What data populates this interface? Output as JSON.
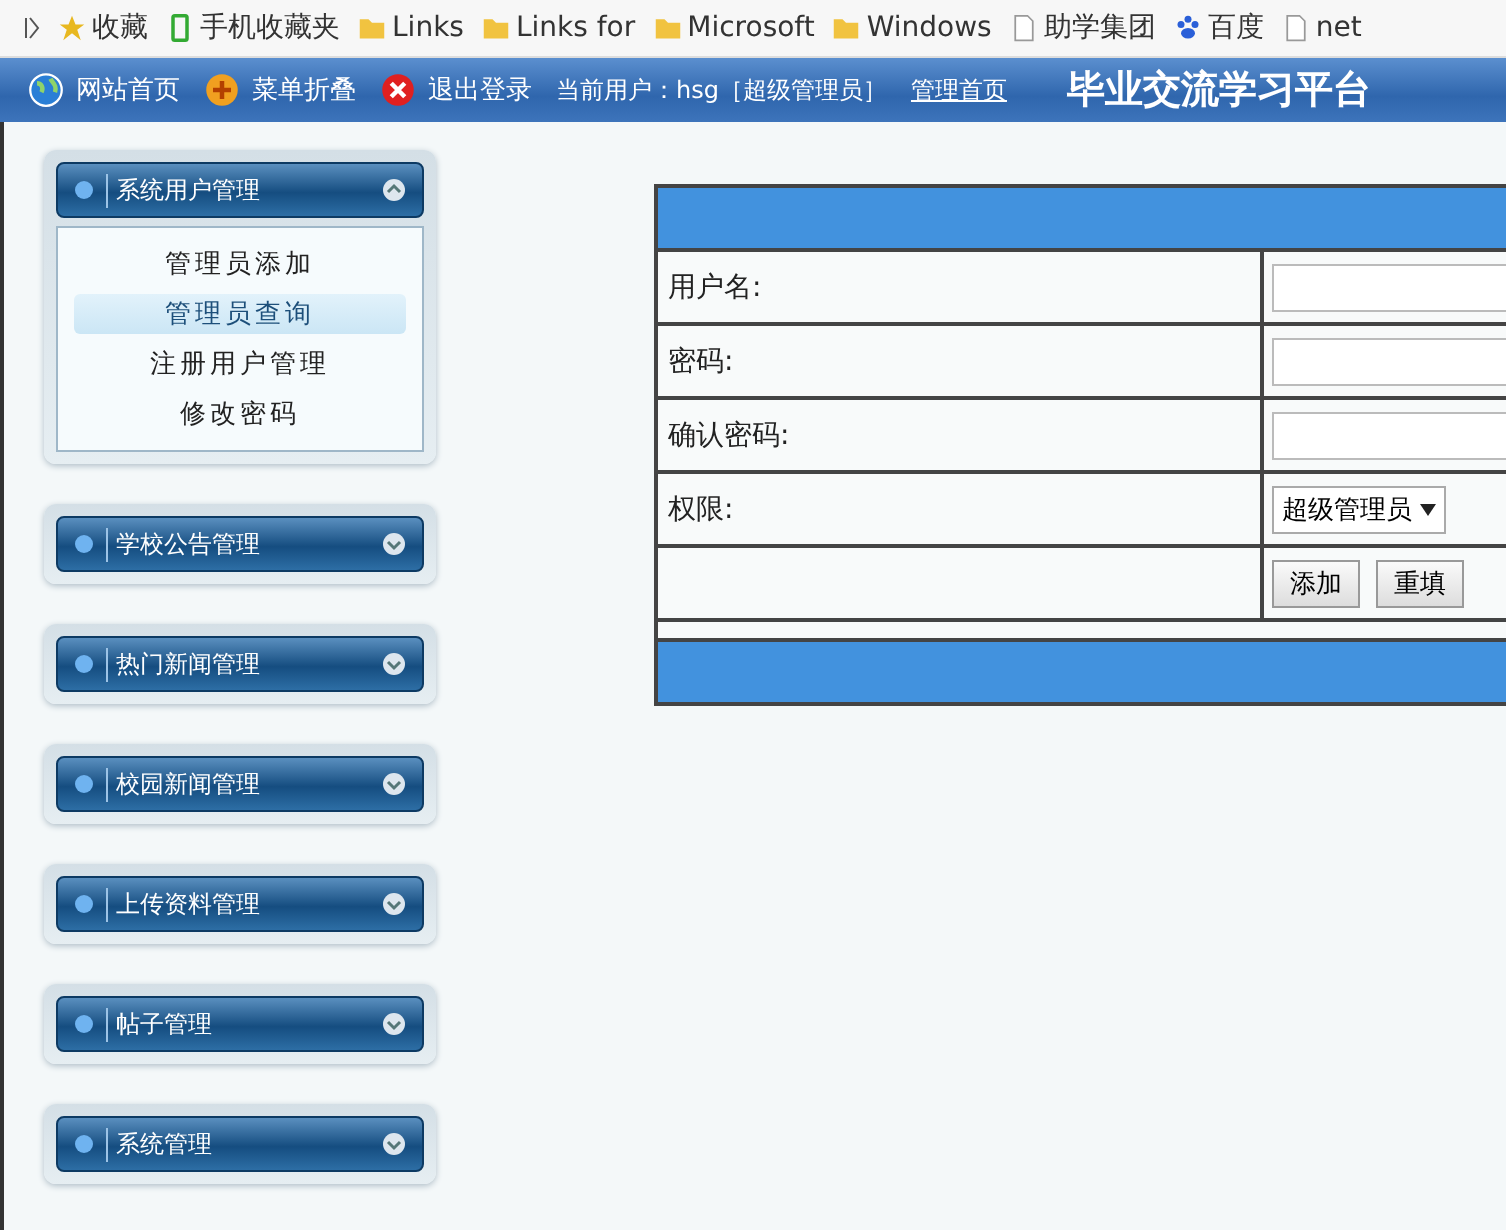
{
  "bookmarks": [
    {
      "label": "收藏",
      "kind": "star"
    },
    {
      "label": "手机收藏夹",
      "kind": "phone"
    },
    {
      "label": "Links",
      "kind": "folder"
    },
    {
      "label": "Links for",
      "kind": "folder"
    },
    {
      "label": "Microsoft",
      "kind": "folder"
    },
    {
      "label": "Windows",
      "kind": "folder"
    },
    {
      "label": "助学集团",
      "kind": "page"
    },
    {
      "label": "百度",
      "kind": "paw"
    },
    {
      "label": "net",
      "kind": "page"
    }
  ],
  "topbar": {
    "links": [
      {
        "label": "网站首页",
        "kind": "globe"
      },
      {
        "label": "菜单折叠",
        "kind": "plus"
      },
      {
        "label": "退出登录",
        "kind": "close"
      }
    ],
    "current_user": "当前用户：hsg［超级管理员］",
    "home_link": "管理首页",
    "title": "毕业交流学习平台"
  },
  "sidebar": [
    {
      "title": "系统用户管理",
      "expanded": true,
      "children": [
        {
          "label": "管理员添加",
          "selected": false
        },
        {
          "label": "管理员查询",
          "selected": true
        },
        {
          "label": "注册用户管理",
          "selected": false
        },
        {
          "label": "修改密码",
          "selected": false
        }
      ]
    },
    {
      "title": "学校公告管理",
      "expanded": false
    },
    {
      "title": "热门新闻管理",
      "expanded": false
    },
    {
      "title": "校园新闻管理",
      "expanded": false
    },
    {
      "title": "上传资料管理",
      "expanded": false
    },
    {
      "title": "帖子管理",
      "expanded": false
    },
    {
      "title": "系统管理",
      "expanded": false
    }
  ],
  "form": {
    "rows": [
      {
        "label": "用户名:",
        "kind": "text"
      },
      {
        "label": "密码:",
        "kind": "password"
      },
      {
        "label": "确认密码:",
        "kind": "password"
      },
      {
        "label": "权限:",
        "kind": "select",
        "value": "超级管理员"
      }
    ],
    "buttons": [
      "添加",
      "重填"
    ]
  }
}
